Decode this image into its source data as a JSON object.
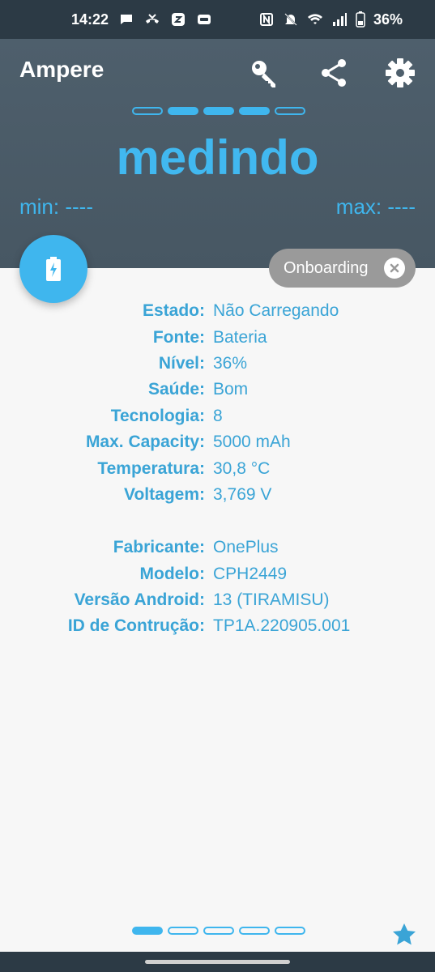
{
  "status_bar": {
    "time": "14:22",
    "battery_percent": "36%"
  },
  "app": {
    "title": "Ampere"
  },
  "measure": {
    "state": "medindo",
    "min": "min: ----",
    "max": "max: ----",
    "progress_dashes_filled": [
      false,
      true,
      true,
      true,
      false
    ]
  },
  "chip": {
    "label": "Onboarding"
  },
  "battery_info": [
    {
      "key": "Estado:",
      "value": "Não Carregando"
    },
    {
      "key": "Fonte:",
      "value": "Bateria"
    },
    {
      "key": "Nível:",
      "value": "36%"
    },
    {
      "key": "Saúde:",
      "value": "Bom"
    },
    {
      "key": "Tecnologia:",
      "value": "8"
    },
    {
      "key": "Max. Capacity:",
      "value": "5000 mAh"
    },
    {
      "key": "Temperatura:",
      "value": "30,8 °C"
    },
    {
      "key": "Voltagem:",
      "value": "3,769 V"
    }
  ],
  "device_info": [
    {
      "key": "Fabricante:",
      "value": "OnePlus"
    },
    {
      "key": "Modelo:",
      "value": "CPH2449"
    },
    {
      "key": "Versão Android:",
      "value": "13 (TIRAMISU)"
    },
    {
      "key": "ID de Contrução:",
      "value": "TP1A.220905.001"
    }
  ],
  "page_indicator": [
    true,
    false,
    false,
    false,
    false
  ],
  "colors": {
    "accent": "#3fb6ee",
    "header": "#4e5f6c",
    "status_bar": "#2c3a45"
  },
  "icons": {
    "toolbar": [
      "key-icon",
      "share-icon",
      "gear-icon"
    ],
    "fab": "battery-charging-icon",
    "bottom": "star-icon"
  }
}
